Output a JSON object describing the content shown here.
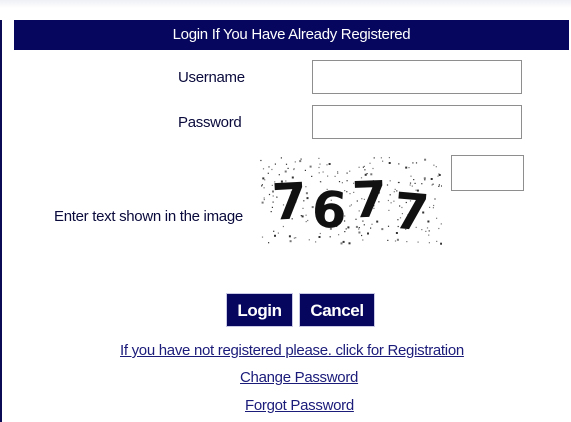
{
  "form": {
    "title": "Login If You Have Already Registered",
    "username_label": "Username",
    "username_value": "",
    "password_label": "Password",
    "password_value": "",
    "captcha_label": "Enter text shown in the image",
    "captcha_text": "7677",
    "captcha_value": ""
  },
  "buttons": {
    "login": "Login",
    "cancel": "Cancel"
  },
  "links": {
    "registration": "If you have not registered please. click for Registration",
    "change_password": "Change Password",
    "forgot_password": "Forgot Password"
  },
  "colors": {
    "header_bg": "#06065e",
    "button_bg": "#06065e",
    "link": "#1b1b7a"
  }
}
